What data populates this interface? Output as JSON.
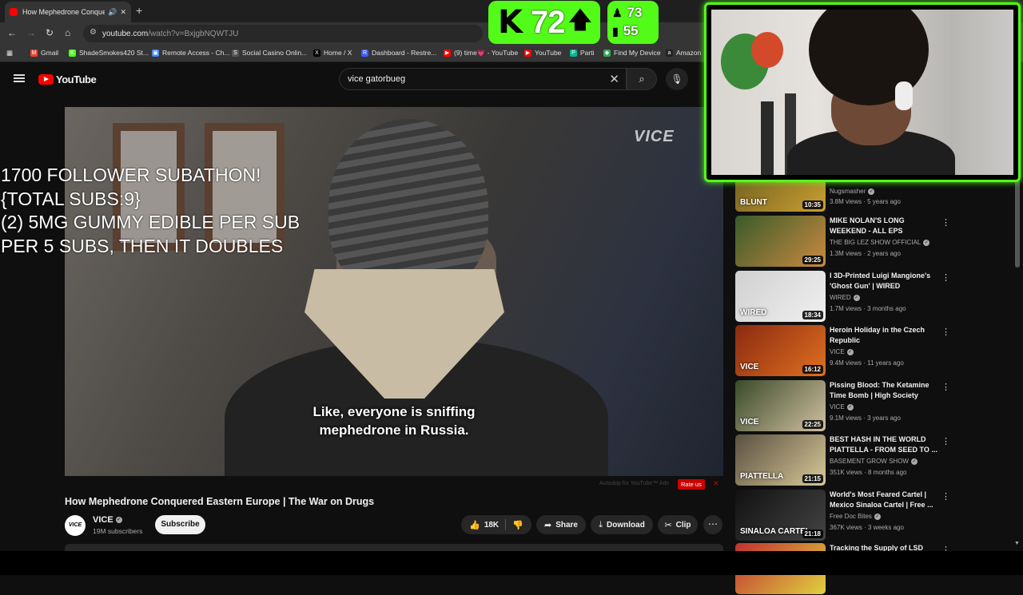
{
  "browser": {
    "tab": {
      "title": "How Mephedrone Conquer",
      "close_glyph": "✕"
    },
    "new_tab_glyph": "+",
    "url": {
      "host": "youtube.com",
      "path": "/watch?v=BxjgbNQWTJU"
    },
    "bookmarks": [
      {
        "label": "Gmail",
        "color": "#ea4335",
        "glyph": "M"
      },
      {
        "label": "ShadeSmokes420 St...",
        "color": "#53fc18",
        "glyph": "K"
      },
      {
        "label": "Remote Access - Ch...",
        "color": "#4285f4",
        "glyph": "▣"
      },
      {
        "label": "Social Casino Onlin...",
        "color": "#555555",
        "glyph": "S"
      },
      {
        "label": "Home / X",
        "color": "#000000",
        "glyph": "X"
      },
      {
        "label": "Dashboard - Restre...",
        "color": "#3d5afe",
        "glyph": "R"
      },
      {
        "label": "(9) time💗 - YouTube",
        "color": "#ff0000",
        "glyph": "▶"
      },
      {
        "label": "YouTube",
        "color": "#ff0000",
        "glyph": "▶"
      },
      {
        "label": "Parti",
        "color": "#00b894",
        "glyph": "P"
      },
      {
        "label": "Find My Device",
        "color": "#34a853",
        "glyph": "◆"
      },
      {
        "label": "Amazon",
        "color": "#222222",
        "glyph": "a"
      }
    ]
  },
  "youtube": {
    "logo_text": "YouTube",
    "search_value": "vice gatorbueg",
    "clear_glyph": "✕",
    "search_glyph": "⌕",
    "mic_glyph": "🎙"
  },
  "player": {
    "watermark": "VICE",
    "caption_line1": "Like, everyone is sniffing",
    "caption_line2": "mephedrone in Russia.",
    "autoskip": "Autoskip for YouTube™ Ads",
    "rate_us": "Rate us",
    "rate_close": "✕"
  },
  "overlay": {
    "lines": [
      "1700 FOLLOWER SUBATHON!",
      "{TOTAL SUBS:9}",
      "(2) 5MG GUMMY EDIBLE PER SUB",
      "PER 5 SUBS, THEN IT DOUBLES"
    ]
  },
  "video": {
    "title": "How Mephedrone Conquered Eastern Europe | The War on Drugs",
    "channel": "VICE",
    "channel_avatar": "VICE",
    "subscribers": "19M subscribers",
    "subscribe_label": "Subscribe",
    "likes": "18K",
    "share_label": "Share",
    "download_label": "Download",
    "clip_label": "Clip",
    "more_glyph": "⋯"
  },
  "recommendations": [
    {
      "title": "",
      "channel": "Nugsmasher",
      "views": "3.8M views · 5 years ago",
      "duration": "10:35",
      "color1": "#6b5a20",
      "color2": "#c9a030",
      "thumb_text": "BLUNT"
    },
    {
      "title": "MIKE NOLAN'S LONG WEEKEND - ALL EPS",
      "channel": "THE BIG LEZ SHOW OFFICIAL",
      "views": "1.3M views · 2 years ago",
      "duration": "29:25",
      "color1": "#3a5a2a",
      "color2": "#c98a40",
      "thumb_text": ""
    },
    {
      "title": "I 3D-Printed Luigi Mangione's 'Ghost Gun' | WIRED",
      "channel": "WIRED",
      "views": "1.7M views · 3 months ago",
      "duration": "18:34",
      "color1": "#d0d0d0",
      "color2": "#f0f0f0",
      "thumb_text": "WIRED"
    },
    {
      "title": "Heroin Holiday in the Czech Republic",
      "channel": "VICE",
      "views": "9.4M views · 11 years ago",
      "duration": "16:12",
      "color1": "#8a2a10",
      "color2": "#e07020",
      "thumb_text": "VICE"
    },
    {
      "title": "Pissing Blood: The Ketamine Time Bomb | High Society",
      "channel": "VICE",
      "views": "9.1M views · 3 years ago",
      "duration": "22:25",
      "color1": "#3a4a2a",
      "color2": "#d0c0a0",
      "thumb_text": "VICE"
    },
    {
      "title": "BEST HASH IN THE WORLD PIATTELLA - FROM SEED TO ...",
      "channel": "BASEMENT GROW SHOW",
      "views": "351K views · 8 months ago",
      "duration": "21:15",
      "color1": "#5a5040",
      "color2": "#d8c898",
      "thumb_text": "PIATTELLA"
    },
    {
      "title": "World's Most Feared Cartel | Mexico Sinaloa Cartel | Free ...",
      "channel": "Free Doc Bites",
      "views": "367K views · 3 weeks ago",
      "duration": "21:18",
      "color1": "#111111",
      "color2": "#444444",
      "thumb_text": "SINALOA CARTEL"
    },
    {
      "title": "Tracking the Supply of LSD (Full",
      "channel": "",
      "views": "",
      "duration": "",
      "color1": "#c03030",
      "color2": "#e0d040",
      "thumb_text": ""
    }
  ],
  "kick_widget": {
    "logo": "K",
    "count": "72",
    "arrow": "🡅",
    "stat1": "73",
    "stat2": "55",
    "accent": "#53fc18"
  },
  "webcam": {
    "accent": "#53fc18"
  }
}
